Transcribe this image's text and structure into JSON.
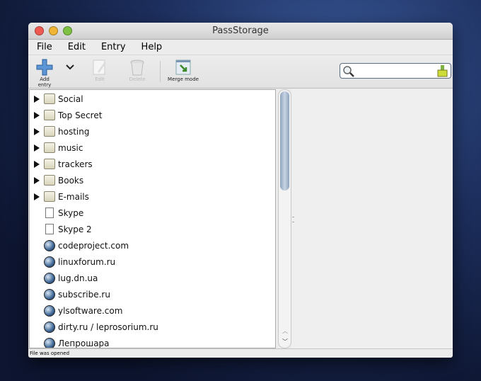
{
  "window": {
    "title": "PassStorage"
  },
  "menu": [
    "File",
    "Edit",
    "Entry",
    "Help"
  ],
  "toolbar": {
    "add": "Add entry",
    "edit": "Edit",
    "delete": "Delete",
    "merge": "Merge mode"
  },
  "search": {
    "value": ""
  },
  "tree": [
    {
      "label": "Social",
      "type": "folder"
    },
    {
      "label": "Top Secret",
      "type": "folder"
    },
    {
      "label": "hosting",
      "type": "folder"
    },
    {
      "label": "music",
      "type": "folder"
    },
    {
      "label": "trackers",
      "type": "folder"
    },
    {
      "label": "Books",
      "type": "folder"
    },
    {
      "label": "E-mails",
      "type": "folder"
    },
    {
      "label": "Skype",
      "type": "document"
    },
    {
      "label": "Skype 2",
      "type": "document"
    },
    {
      "label": "codeproject.com",
      "type": "web"
    },
    {
      "label": "linuxforum.ru",
      "type": "web"
    },
    {
      "label": "lug.dn.ua",
      "type": "web"
    },
    {
      "label": "subscribe.ru",
      "type": "web"
    },
    {
      "label": "ylsoftware.com",
      "type": "web"
    },
    {
      "label": "dirty.ru / leprosorium.ru",
      "type": "web"
    },
    {
      "label": "Лепрошара",
      "type": "web"
    }
  ],
  "status": "File was opened"
}
